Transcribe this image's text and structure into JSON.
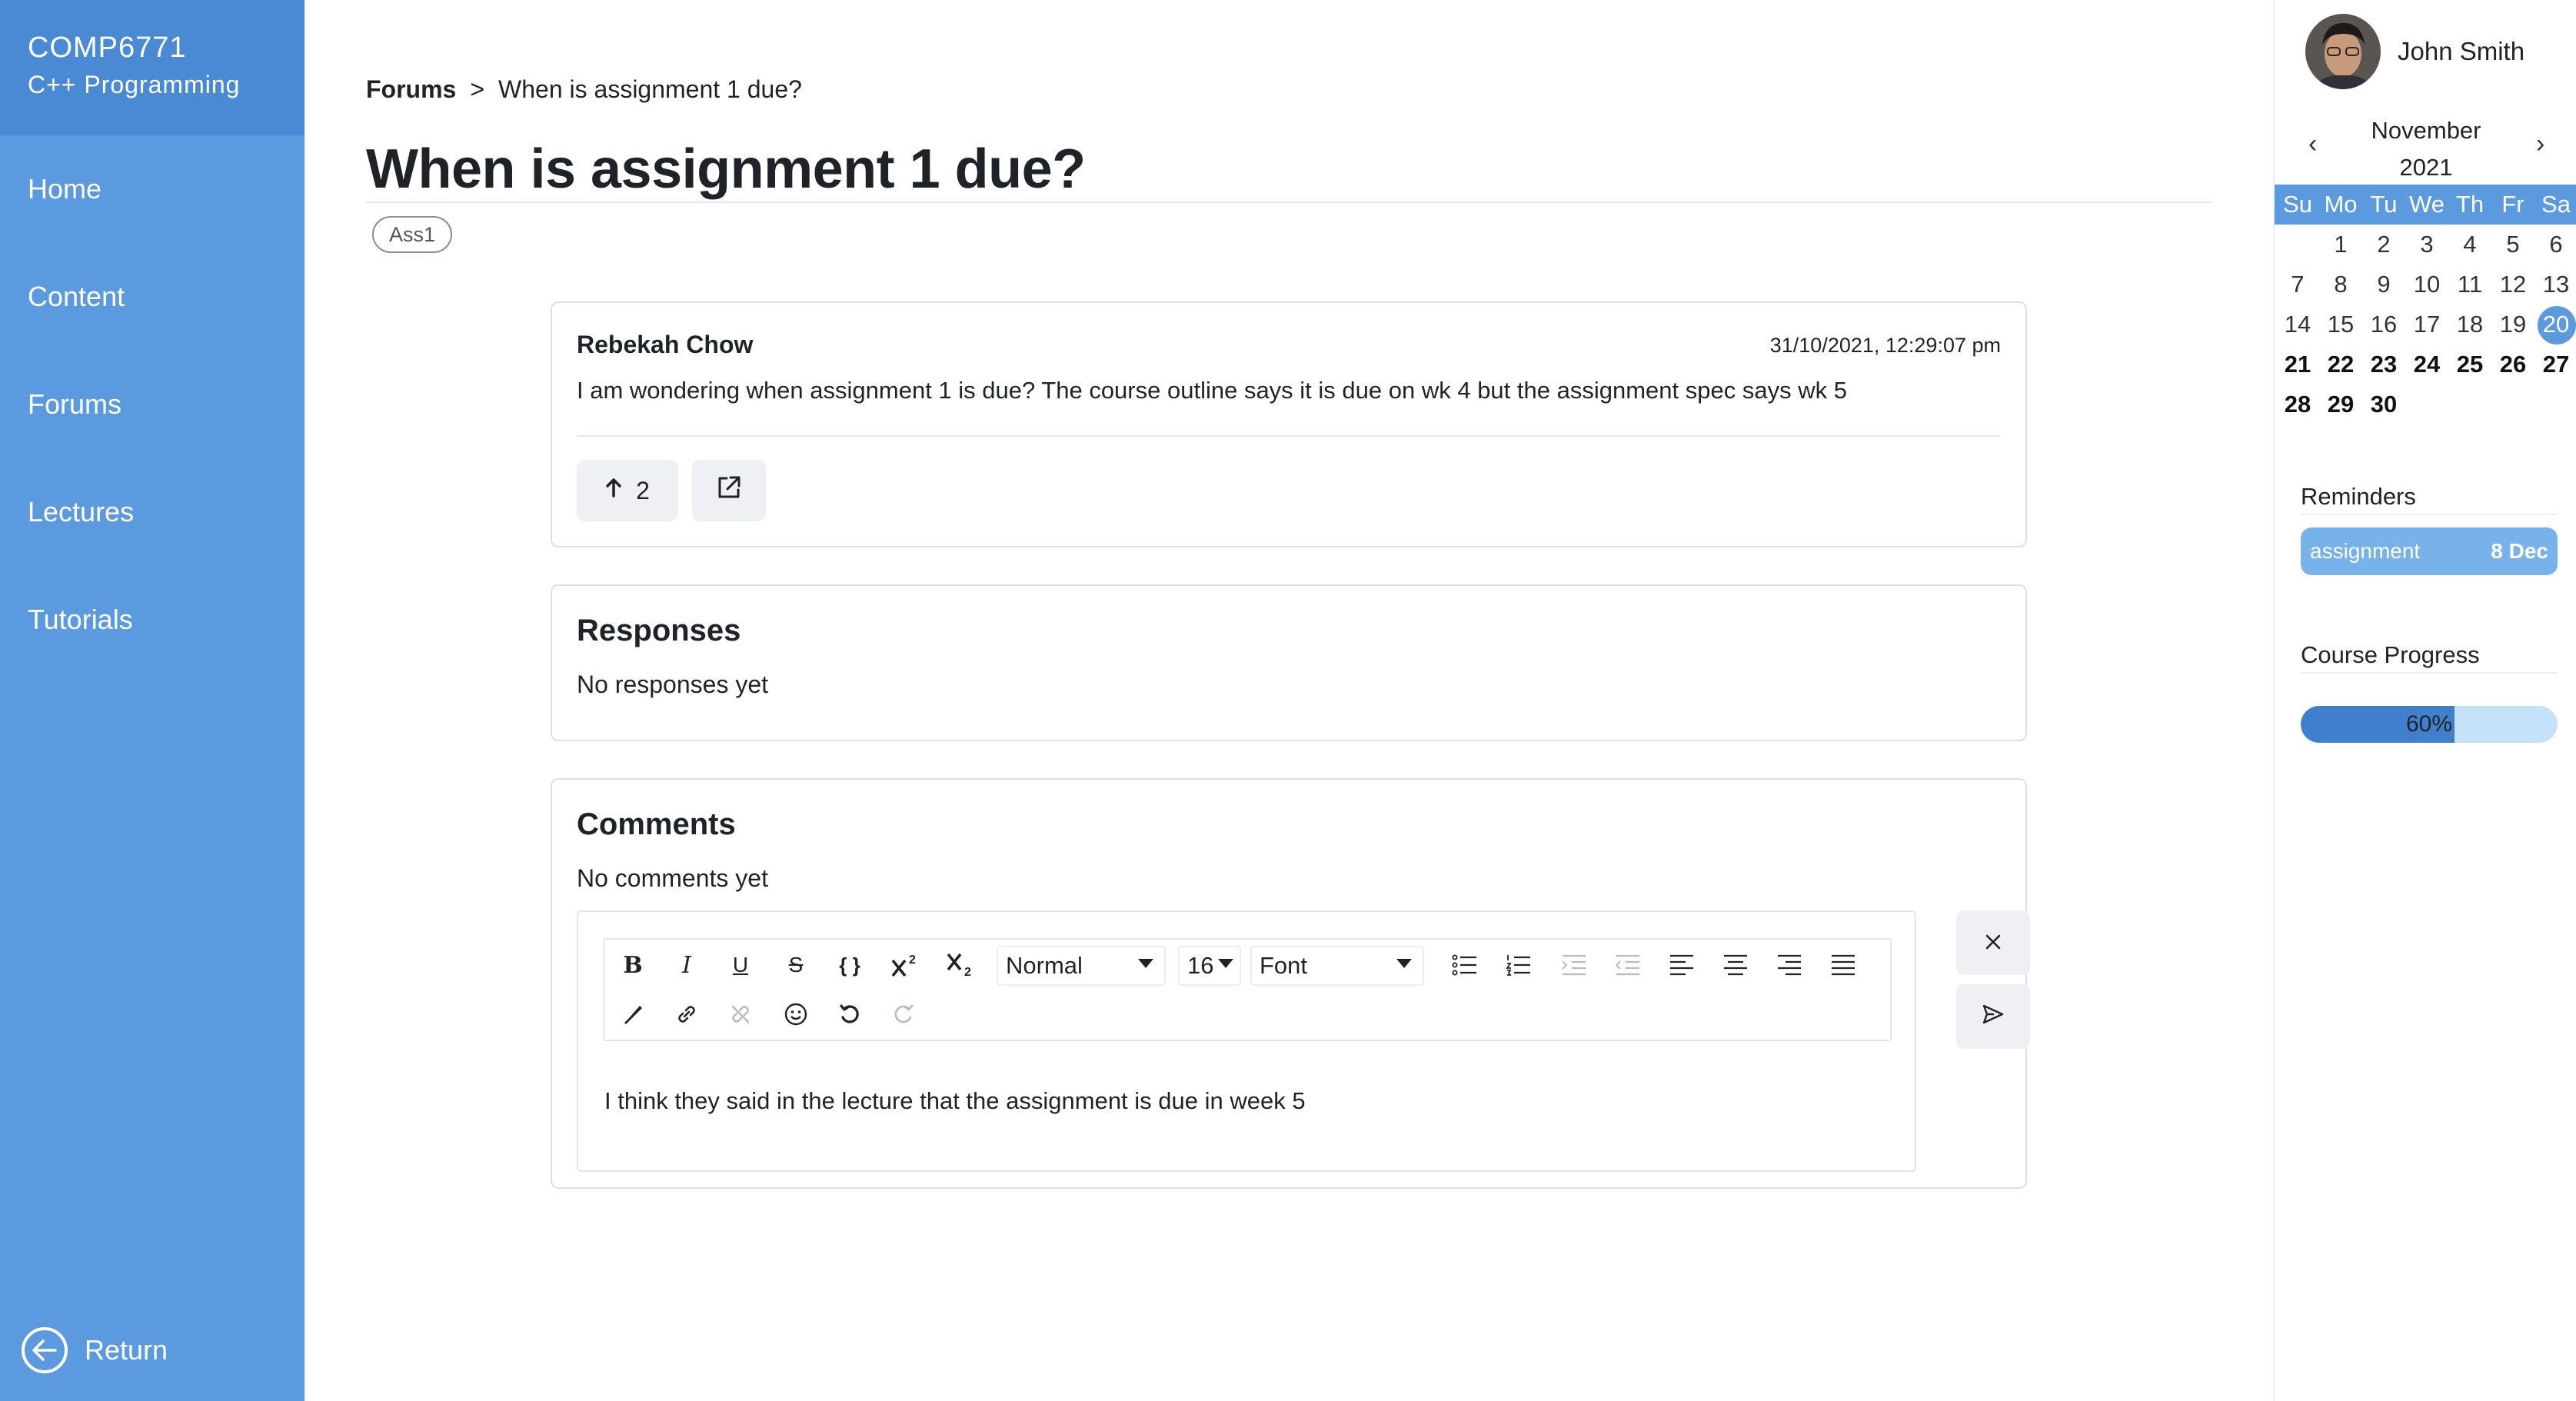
{
  "sidebar": {
    "course_code": "COMP6771",
    "course_name": "C++ Programming",
    "items": [
      {
        "label": "Home"
      },
      {
        "label": "Content"
      },
      {
        "label": "Forums"
      },
      {
        "label": "Lectures"
      },
      {
        "label": "Tutorials"
      }
    ],
    "return_label": "Return"
  },
  "breadcrumb": {
    "root": "Forums",
    "separator": ">",
    "current": "When is assignment 1 due?"
  },
  "post": {
    "title": "When is assignment 1 due?",
    "tag": "Ass1",
    "author": "Rebekah Chow",
    "timestamp": "31/10/2021, 12:29:07 pm",
    "body": "I am wondering when assignment 1 is due? The course outline says it is due on wk 4 but the assignment spec says wk 5",
    "upvotes": "2",
    "upvote_icon": "arrow-up-icon",
    "share_icon": "external-link-icon"
  },
  "responses": {
    "title": "Responses",
    "empty_text": "No responses yet"
  },
  "comments": {
    "title": "Comments",
    "empty_text": "No comments yet",
    "editor": {
      "text": "I think they said in the lecture that the assignment is due in week 5",
      "toolbar": {
        "bold": "B",
        "italic": "I",
        "underline": "U",
        "strike": "S",
        "code": "{ }",
        "block_type": "Normal",
        "font_size": "16",
        "font_family": "Font"
      }
    }
  },
  "user": {
    "name": "John Smith"
  },
  "calendar": {
    "month": "November",
    "year": "2021",
    "prev": "‹",
    "next": "›",
    "weekdays": [
      "Su",
      "Mo",
      "Tu",
      "We",
      "Th",
      "Fr",
      "Sa"
    ],
    "weeks": [
      [
        "",
        "1",
        "2",
        "3",
        "4",
        "5",
        "6"
      ],
      [
        "7",
        "8",
        "9",
        "10",
        "11",
        "12",
        "13"
      ],
      [
        "14",
        "15",
        "16",
        "17",
        "18",
        "19",
        "20"
      ],
      [
        "21",
        "22",
        "23",
        "24",
        "25",
        "26",
        "27"
      ],
      [
        "28",
        "29",
        "30",
        "",
        "",
        "",
        ""
      ]
    ],
    "today": "20"
  },
  "reminders": {
    "title": "Reminders",
    "items": [
      {
        "label": "assignment",
        "date": "8 Dec"
      }
    ]
  },
  "progress": {
    "title": "Course Progress",
    "value_fraction": 0.6,
    "label": "60%"
  },
  "colors": {
    "sidebar": "#5b9ade",
    "sidebar_header": "#4a8ad4",
    "progress_fill": "#3f7fcc",
    "progress_track": "#c6e2f8",
    "reminder": "#78b2ea"
  }
}
